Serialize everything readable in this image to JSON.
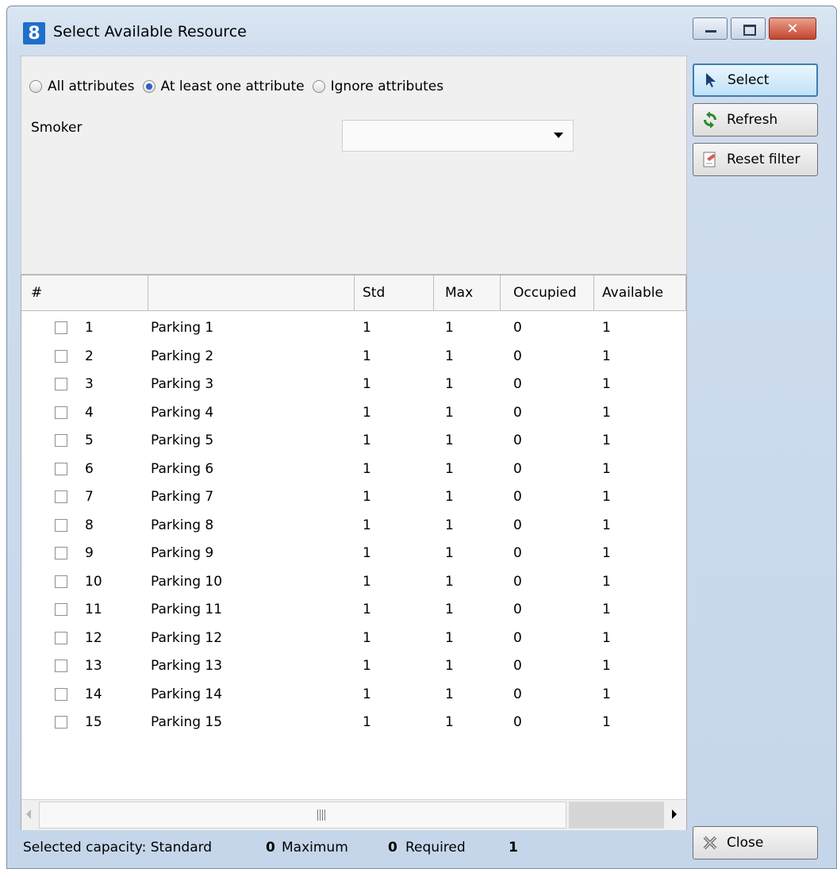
{
  "window": {
    "icon_text": "8",
    "title": "Select Available Resource",
    "icon_names": [
      "minimize-icon",
      "maximize-icon",
      "close-icon"
    ]
  },
  "filter": {
    "radios": [
      {
        "label": "All attributes",
        "checked": false
      },
      {
        "label": "At least one attribute",
        "checked": true
      },
      {
        "label": "Ignore attributes",
        "checked": false
      }
    ],
    "smoker_label": "Smoker",
    "smoker_value": ""
  },
  "grid": {
    "columns": [
      "#",
      "",
      "Std",
      "Max",
      "Occupied",
      "Available"
    ],
    "rows": [
      {
        "num": "1",
        "name": "Parking 1",
        "std": "1",
        "max": "1",
        "occupied": "0",
        "available": "1"
      },
      {
        "num": "2",
        "name": "Parking 2",
        "std": "1",
        "max": "1",
        "occupied": "0",
        "available": "1"
      },
      {
        "num": "3",
        "name": "Parking 3",
        "std": "1",
        "max": "1",
        "occupied": "0",
        "available": "1"
      },
      {
        "num": "4",
        "name": "Parking 4",
        "std": "1",
        "max": "1",
        "occupied": "0",
        "available": "1"
      },
      {
        "num": "5",
        "name": "Parking 5",
        "std": "1",
        "max": "1",
        "occupied": "0",
        "available": "1"
      },
      {
        "num": "6",
        "name": "Parking 6",
        "std": "1",
        "max": "1",
        "occupied": "0",
        "available": "1"
      },
      {
        "num": "7",
        "name": "Parking 7",
        "std": "1",
        "max": "1",
        "occupied": "0",
        "available": "1"
      },
      {
        "num": "8",
        "name": "Parking 8",
        "std": "1",
        "max": "1",
        "occupied": "0",
        "available": "1"
      },
      {
        "num": "9",
        "name": "Parking 9",
        "std": "1",
        "max": "1",
        "occupied": "0",
        "available": "1"
      },
      {
        "num": "10",
        "name": "Parking 10",
        "std": "1",
        "max": "1",
        "occupied": "0",
        "available": "1"
      },
      {
        "num": "11",
        "name": "Parking 11",
        "std": "1",
        "max": "1",
        "occupied": "0",
        "available": "1"
      },
      {
        "num": "12",
        "name": "Parking 12",
        "std": "1",
        "max": "1",
        "occupied": "0",
        "available": "1"
      },
      {
        "num": "13",
        "name": "Parking 13",
        "std": "1",
        "max": "1",
        "occupied": "0",
        "available": "1"
      },
      {
        "num": "14",
        "name": "Parking 14",
        "std": "1",
        "max": "1",
        "occupied": "0",
        "available": "1"
      },
      {
        "num": "15",
        "name": "Parking 15",
        "std": "1",
        "max": "1",
        "occupied": "0",
        "available": "1"
      }
    ]
  },
  "buttons": {
    "select": "Select",
    "refresh": "Refresh",
    "reset_filter": "Reset filter",
    "close": "Close"
  },
  "status": {
    "prefix": "Selected capacity: Standard",
    "standard": "0",
    "maximum_label": "Maximum",
    "maximum": "0",
    "required_label": "Required",
    "required": "1"
  },
  "colors": {
    "title_bg": "#cfddee",
    "close_btn": "#c5442c",
    "accent_blue": "#2a62c9"
  }
}
